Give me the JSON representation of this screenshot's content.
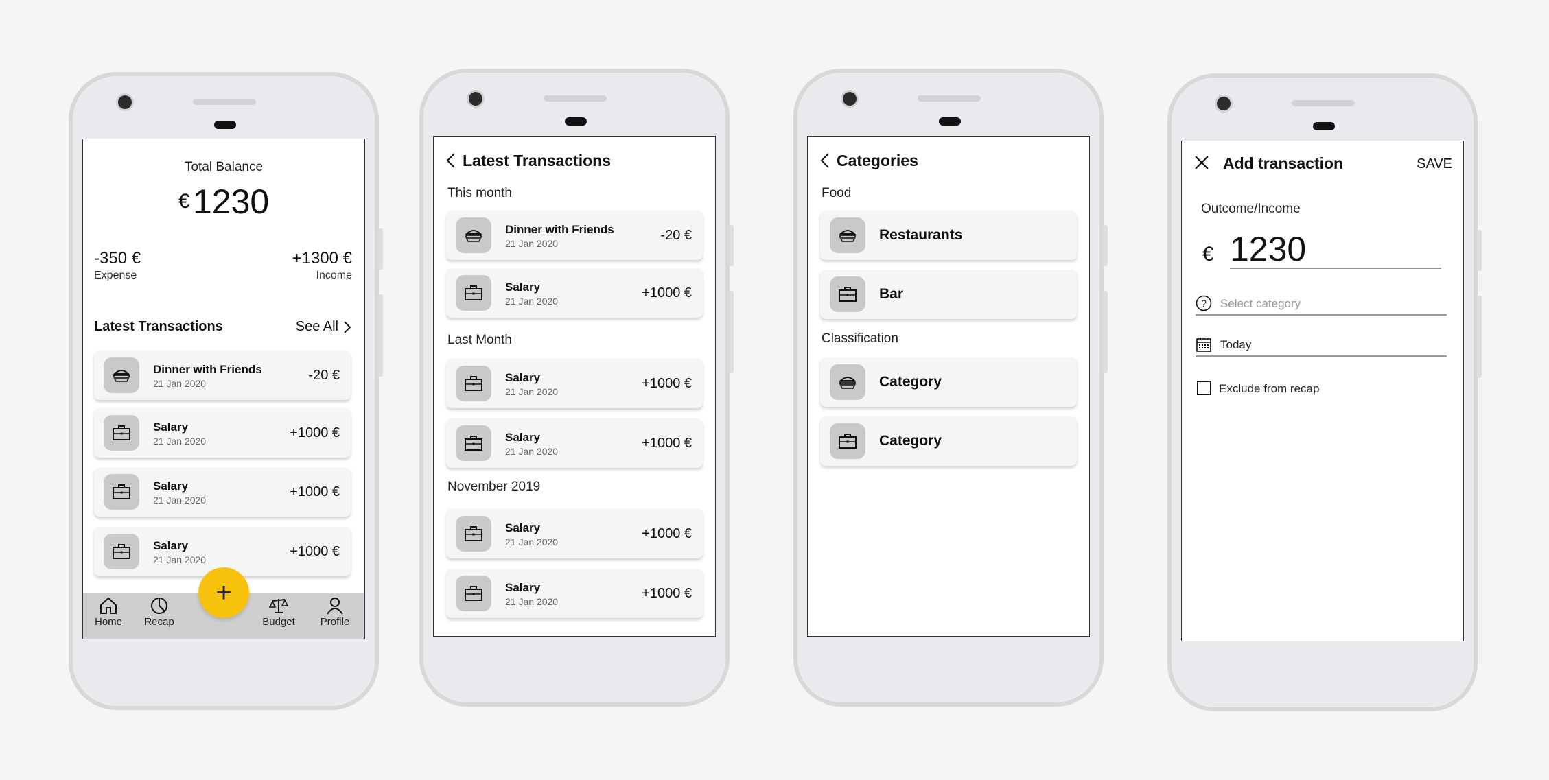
{
  "colors": {
    "accent": "#f7c20e",
    "icon_bg": "#c9c9c9",
    "nav_bg": "#cfcfcf"
  },
  "screen1": {
    "balance_label": "Total Balance",
    "currency": "€",
    "balance": "1230",
    "expense_value": "-350 €",
    "expense_label": "Expense",
    "income_value": "+1300 €",
    "income_label": "Income",
    "latest_title": "Latest Transactions",
    "see_all": "See All",
    "transactions": [
      {
        "icon": "burger-icon",
        "title": "Dinner with Friends",
        "date": "21 Jan 2020",
        "amount": "-20 €"
      },
      {
        "icon": "briefcase-icon",
        "title": "Salary",
        "date": "21 Jan 2020",
        "amount": "+1000 €"
      },
      {
        "icon": "briefcase-icon",
        "title": "Salary",
        "date": "21 Jan 2020",
        "amount": "+1000 €"
      },
      {
        "icon": "briefcase-icon",
        "title": "Salary",
        "date": "21 Jan 2020",
        "amount": "+1000 €"
      }
    ],
    "fab": "+",
    "nav": {
      "home": "Home",
      "recap": "Recap",
      "budget": "Budget",
      "profile": "Profile"
    }
  },
  "screen2": {
    "title": "Latest Transactions",
    "sections": [
      {
        "label": "This month",
        "items": [
          {
            "icon": "burger-icon",
            "title": "Dinner with Friends",
            "date": "21 Jan 2020",
            "amount": "-20 €"
          },
          {
            "icon": "briefcase-icon",
            "title": "Salary",
            "date": "21 Jan 2020",
            "amount": "+1000 €"
          }
        ]
      },
      {
        "label": "Last Month",
        "items": [
          {
            "icon": "briefcase-icon",
            "title": "Salary",
            "date": "21 Jan 2020",
            "amount": "+1000 €"
          },
          {
            "icon": "briefcase-icon",
            "title": "Salary",
            "date": "21 Jan 2020",
            "amount": "+1000 €"
          }
        ]
      },
      {
        "label": "November 2019",
        "items": [
          {
            "icon": "briefcase-icon",
            "title": "Salary",
            "date": "21 Jan 2020",
            "amount": "+1000 €"
          },
          {
            "icon": "briefcase-icon",
            "title": "Salary",
            "date": "21 Jan 2020",
            "amount": "+1000 €"
          }
        ]
      }
    ]
  },
  "screen3": {
    "title": "Categories",
    "sections": [
      {
        "label": "Food",
        "items": [
          {
            "icon": "burger-icon",
            "name": "Restaurants"
          },
          {
            "icon": "briefcase-icon",
            "name": "Bar"
          }
        ]
      },
      {
        "label": "Classification",
        "items": [
          {
            "icon": "burger-icon",
            "name": "Category"
          },
          {
            "icon": "briefcase-icon",
            "name": "Category"
          }
        ]
      }
    ]
  },
  "screen4": {
    "title": "Add transaction",
    "save": "SAVE",
    "type_label": "Outcome/Income",
    "currency": "€",
    "amount": "1230",
    "category_placeholder": "Select category",
    "date_value": "Today",
    "exclude_label": "Exclude from recap"
  }
}
